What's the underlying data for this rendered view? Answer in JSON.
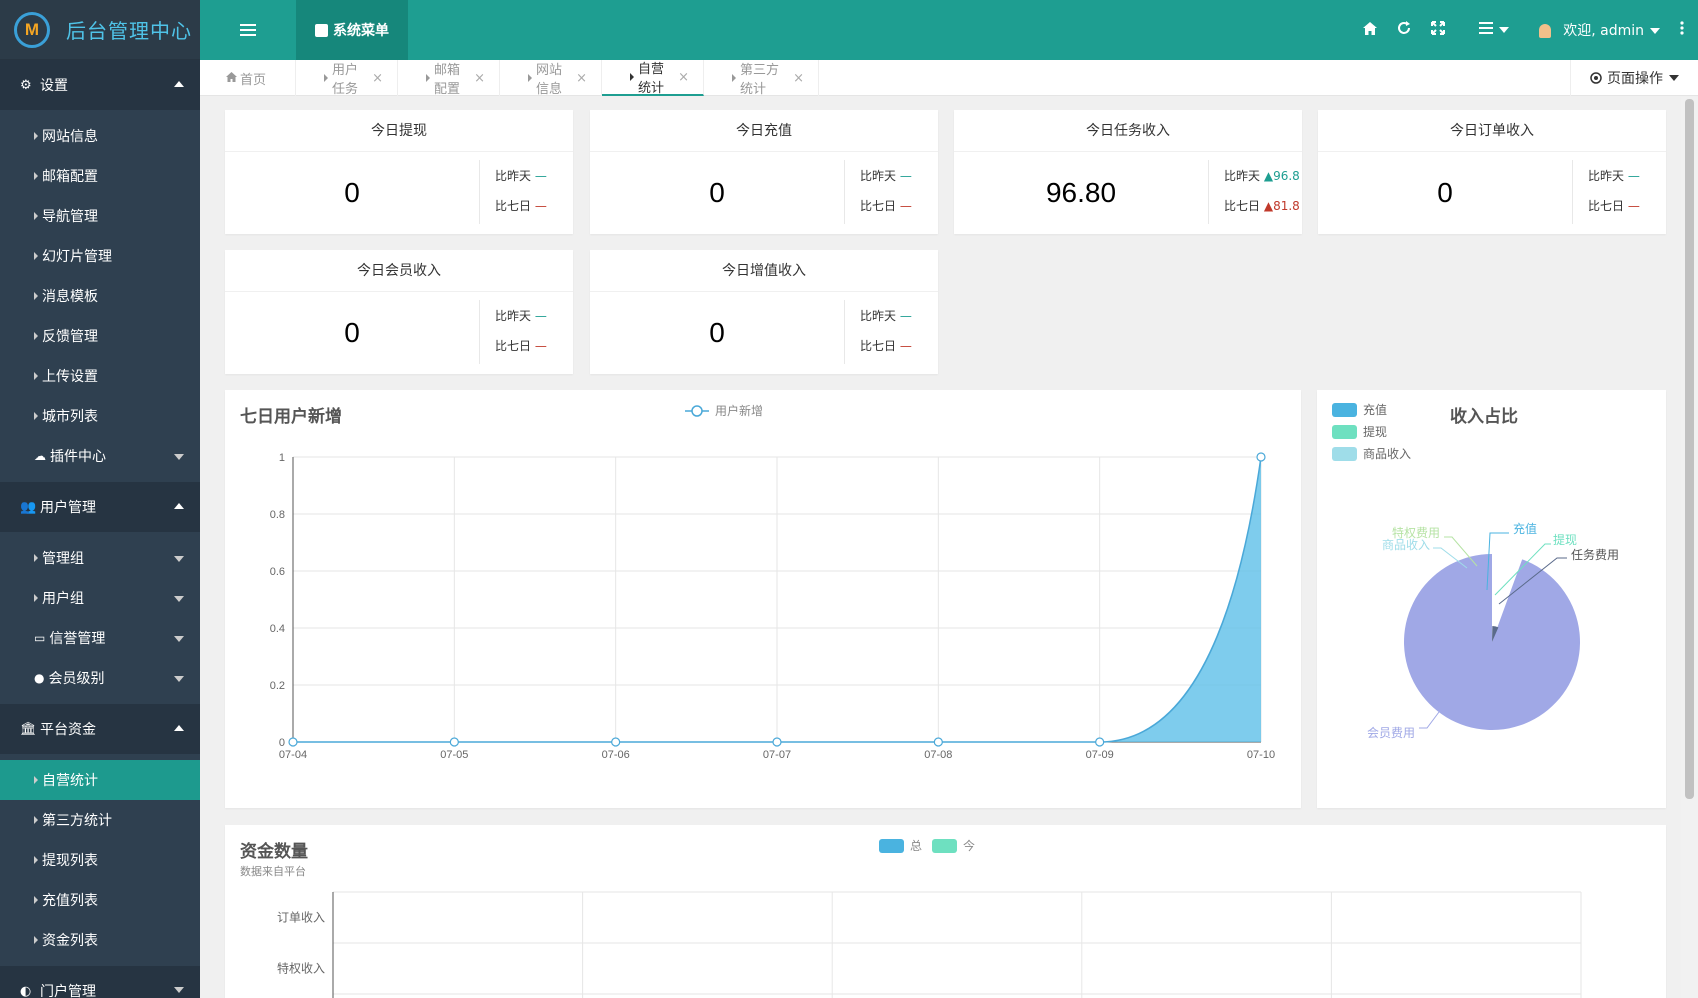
{
  "app": {
    "title": "后台管理中心",
    "logo_letter": "M"
  },
  "sidebar": {
    "groups": [
      {
        "label": "设置",
        "items": [
          "网站信息",
          "邮箱配置",
          "导航管理",
          "幻灯片管理",
          "消息模板",
          "反馈管理",
          "上传设置",
          "城市列表",
          "插件中心"
        ]
      },
      {
        "label": "用户管理",
        "items": [
          "管理组",
          "用户组",
          "信誉管理",
          "会员级别"
        ]
      },
      {
        "label": "平台资金",
        "items": [
          "自营统计",
          "第三方统计",
          "提现列表",
          "充值列表",
          "资金列表"
        ]
      },
      {
        "label": "门户管理"
      }
    ],
    "active_item": "自营统计"
  },
  "header": {
    "system_menu": "系统菜单",
    "welcome": "欢迎, admin",
    "icons": [
      "home-icon",
      "refresh-icon",
      "fullscreen-icon",
      "list-icon",
      "user-icon",
      "more-icon"
    ]
  },
  "tabs": {
    "items": [
      "首页",
      "用户任务",
      "邮箱配置",
      "网站信息",
      "自营统计",
      "第三方统计"
    ],
    "active": "自营统计",
    "page_ops": "页面操作"
  },
  "stats": [
    {
      "title": "今日提现",
      "value": "0",
      "vs_yesterday_label": "比昨天",
      "vs_yesterday": "—",
      "vs_week_label": "比七日",
      "vs_week": "—"
    },
    {
      "title": "今日充值",
      "value": "0",
      "vs_yesterday_label": "比昨天",
      "vs_yesterday": "—",
      "vs_week_label": "比七日",
      "vs_week": "—"
    },
    {
      "title": "今日任务收入",
      "value": "96.80",
      "vs_yesterday_label": "比昨天",
      "vs_yesterday": "▲96.8",
      "vs_week_label": "比七日",
      "vs_week": "▲81.8"
    },
    {
      "title": "今日订单收入",
      "value": "0",
      "vs_yesterday_label": "比昨天",
      "vs_yesterday": "—",
      "vs_week_label": "比七日",
      "vs_week": "—"
    },
    {
      "title": "今日会员收入",
      "value": "0",
      "vs_yesterday_label": "比昨天",
      "vs_yesterday": "—",
      "vs_week_label": "比七日",
      "vs_week": "—"
    },
    {
      "title": "今日增值收入",
      "value": "0",
      "vs_yesterday_label": "比昨天",
      "vs_yesterday": "—",
      "vs_week_label": "比七日",
      "vs_week": "—"
    }
  ],
  "colors": {
    "accent": "#1e9e91",
    "sidebar": "#2f4050",
    "down": "#c0392b"
  },
  "chart_data": [
    {
      "type": "area",
      "title": "七日用户新增",
      "legend": [
        "用户新增"
      ],
      "x": [
        "07-04",
        "07-05",
        "07-06",
        "07-07",
        "07-08",
        "07-09",
        "07-10"
      ],
      "series": [
        {
          "name": "用户新增",
          "values": [
            0,
            0,
            0,
            0,
            0,
            0,
            1
          ]
        }
      ],
      "ylim": [
        0,
        1
      ],
      "yticks": [
        "0",
        "0.2",
        "0.4",
        "0.6",
        "0.8",
        "1"
      ],
      "grid": true,
      "color": "#5ebfe9"
    },
    {
      "type": "pie",
      "title": "收入占比",
      "legend": [
        "充值",
        "提现",
        "商品收入"
      ],
      "legend_colors": [
        "#4ab3e0",
        "#6ee0c0",
        "#9fdde9"
      ],
      "slices": [
        {
          "label": "会员费用",
          "value": 75,
          "color": "#a0a8e6"
        },
        {
          "label": "任务费用",
          "value": 5,
          "color": "#5a6a8a"
        },
        {
          "label": "充值",
          "value": 0,
          "color": "#4ab3e0"
        },
        {
          "label": "提现",
          "value": 0,
          "color": "#6ee0c0"
        },
        {
          "label": "商品收入",
          "value": 0,
          "color": "#9fdde9"
        },
        {
          "label": "特权费用",
          "value": 0,
          "color": "#b6e3a4"
        }
      ],
      "radius_type": "rose"
    },
    {
      "type": "bar",
      "title": "资金数量",
      "subtitle": "数据来自平台",
      "legend": [
        "总",
        "今"
      ],
      "legend_colors": [
        "#4ab3e0",
        "#6ee0c0"
      ],
      "categories": [
        "订单收入",
        "特权收入"
      ],
      "series": [
        {
          "name": "总",
          "values": [
            0,
            0
          ]
        },
        {
          "name": "今",
          "values": [
            0,
            0
          ]
        }
      ],
      "grid": true
    }
  ]
}
